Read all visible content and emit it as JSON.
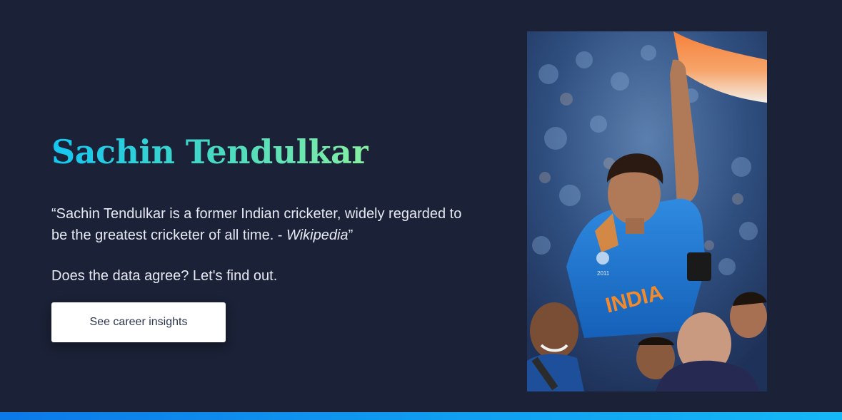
{
  "hero": {
    "title": "Sachin Tendulkar",
    "quote_text": "“Sachin Tendulkar is a former Indian cricketer, widely regarded to be the greatest cricketer of all time. - ",
    "quote_source": "Wikipedia",
    "quote_close": "”",
    "prompt": "Does the data agree? Let's find out.",
    "cta_label": "See career insights",
    "photo_alt": "Sachin Tendulkar",
    "photo_jersey_text": "INDIA",
    "photo_badge_year": "2011"
  },
  "colors": {
    "background": "#1b2136",
    "title_gradient_start": "#14c6f2",
    "title_gradient_end": "#86f0a1",
    "body_text": "#e6e9f2",
    "button_bg": "#ffffff",
    "button_text": "#2c3650",
    "bottom_bar": "#0f9cf0"
  }
}
